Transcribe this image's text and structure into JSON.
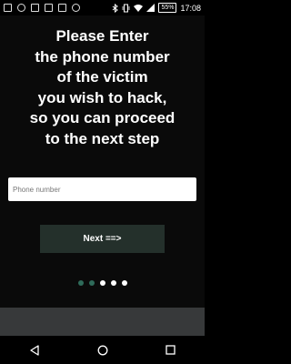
{
  "status_bar": {
    "time": "17:08",
    "battery": "55%",
    "left_icons": [
      "notification-icon",
      "notification-icon",
      "notification-icon",
      "notification-icon",
      "notification-icon",
      "notification-icon"
    ],
    "right_icons": [
      "bluetooth-icon",
      "vibrate-icon",
      "wifi-icon",
      "signal-icon"
    ]
  },
  "main": {
    "headline_lines": [
      "Please Enter",
      "the phone number",
      "of the victim",
      "you wish to hack,",
      "so you can proceed",
      "to the next step"
    ],
    "phone_input": {
      "placeholder": "Phone number",
      "value": ""
    },
    "next_label": "Next ==>"
  },
  "pager": {
    "total": 5,
    "active_indices": [
      0,
      1
    ]
  },
  "colors": {
    "background": "#0a0a0a",
    "button_bg": "#24302b",
    "active_dot": "#2f6b5a",
    "strip": "#37393a"
  },
  "nav_bar": {
    "buttons": [
      "back-icon",
      "home-icon",
      "recents-icon"
    ]
  }
}
